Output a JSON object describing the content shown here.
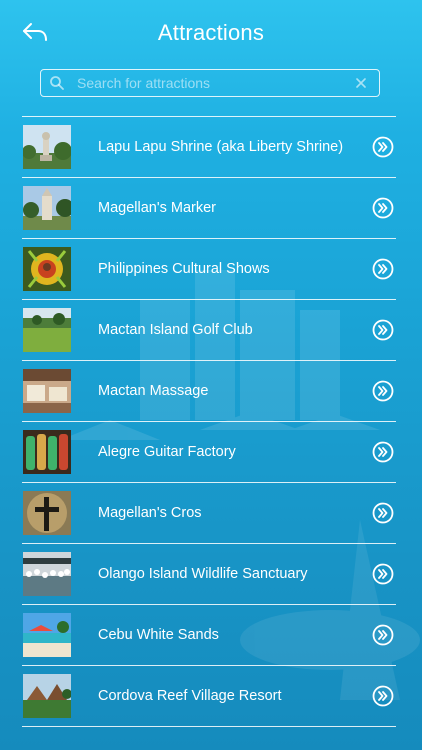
{
  "header": {
    "title": "Attractions"
  },
  "search": {
    "placeholder": "Search for attractions",
    "value": ""
  },
  "attractions": [
    {
      "label": "Lapu Lapu Shrine (aka Liberty Shrine)"
    },
    {
      "label": "Magellan's Marker"
    },
    {
      "label": "Philippines Cultural Shows"
    },
    {
      "label": "Mactan Island Golf Club"
    },
    {
      "label": "Mactan Massage"
    },
    {
      "label": "Alegre Guitar Factory"
    },
    {
      "label": "Magellan's Cros"
    },
    {
      "label": "Olango Island Wildlife Sanctuary"
    },
    {
      "label": "Cebu White Sands"
    },
    {
      "label": "Cordova Reef Village Resort"
    }
  ],
  "colors": {
    "background_top": "#2ec3ee",
    "background_bottom": "#158bbd",
    "text": "#ffffff"
  }
}
